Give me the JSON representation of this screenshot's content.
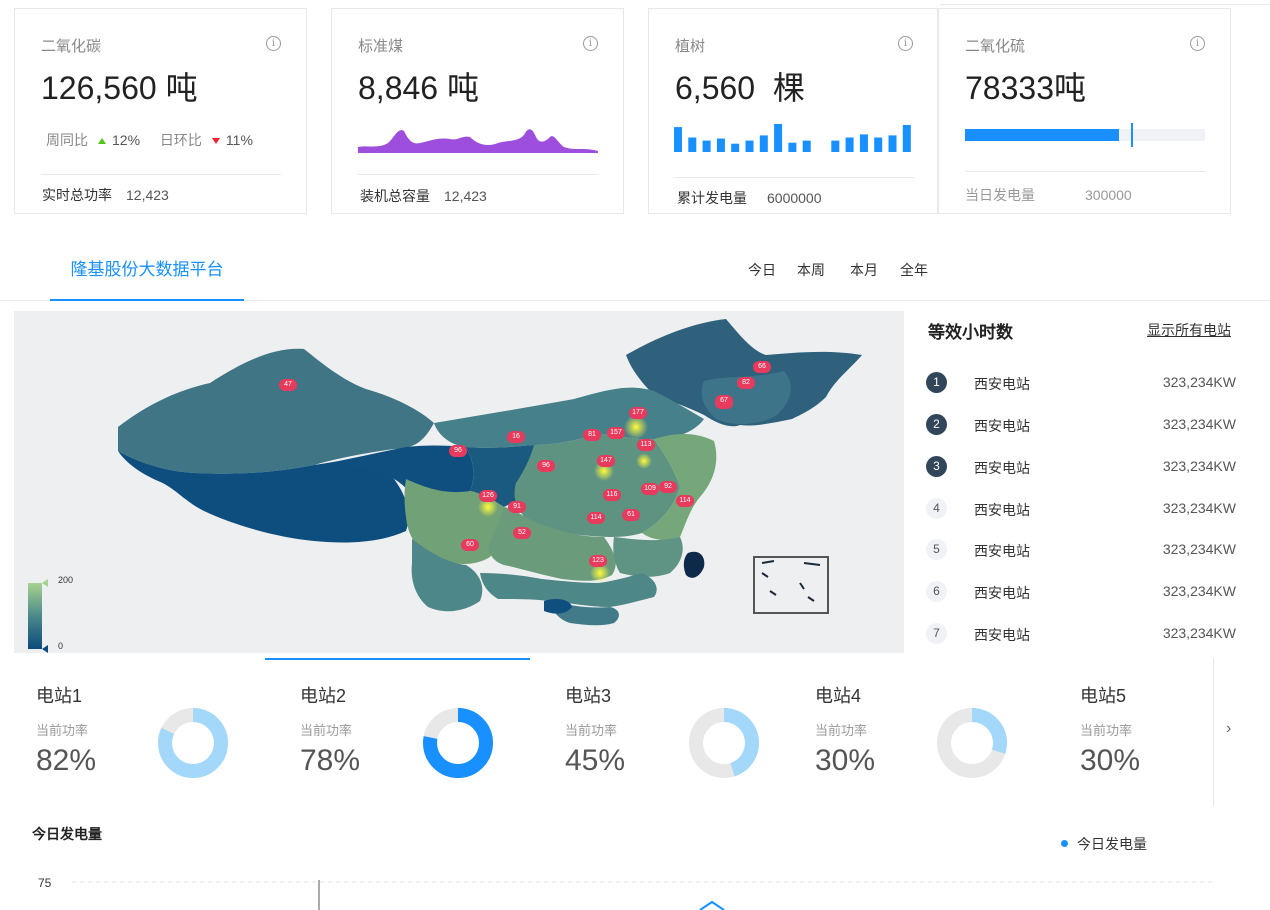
{
  "cards": [
    {
      "title": "二氧化碳",
      "value": "126,560 吨",
      "trend": {
        "week_label": "周同比",
        "week_pct": "12%",
        "day_label": "日环比",
        "day_pct": "11%"
      },
      "footer_label": "实时总功率",
      "footer_value": "12,423"
    },
    {
      "title": "标准煤",
      "value": "8,846 吨",
      "footer_label": "装机总容量",
      "footer_value": "12,423"
    },
    {
      "title": "植树",
      "value": "6,560  棵",
      "bar_values": [
        24,
        14,
        11,
        13,
        8,
        11,
        16,
        27,
        9,
        11,
        0,
        11,
        14,
        17,
        14,
        16,
        26
      ],
      "footer_label": "累计发电量",
      "footer_value": "6000000"
    },
    {
      "title": "二氧化硫",
      "value": "78333吨",
      "progress": 0.64,
      "target": 0.69,
      "footer_label": "当日发电量",
      "footer_value": "300000"
    }
  ],
  "tabs": {
    "main": "隆基股份大数据平台",
    "periods": [
      "今日",
      "本周",
      "本月",
      "全年"
    ]
  },
  "map": {
    "legend": {
      "max": "200",
      "min": "0"
    },
    "markers": [
      "47",
      "177",
      "157",
      "81",
      "113",
      "147",
      "96",
      "126",
      "91",
      "114",
      "61",
      "92",
      "109",
      "116",
      "114",
      "123",
      "52",
      "60",
      "16",
      "96",
      "67",
      "82",
      "67",
      "66"
    ]
  },
  "ranking": {
    "title": "等效小时数",
    "link": "显示所有电站",
    "items": [
      {
        "rank": "1",
        "name": "西安电站",
        "value": "323,234KW"
      },
      {
        "rank": "2",
        "name": "西安电站",
        "value": "323,234KW"
      },
      {
        "rank": "3",
        "name": "西安电站",
        "value": "323,234KW"
      },
      {
        "rank": "4",
        "name": "西安电站",
        "value": "323,234KW"
      },
      {
        "rank": "5",
        "name": "西安电站",
        "value": "323,234KW"
      },
      {
        "rank": "6",
        "name": "西安电站",
        "value": "323,234KW"
      },
      {
        "rank": "7",
        "name": "西安电站",
        "value": "323,234KW"
      }
    ]
  },
  "stations": [
    {
      "name": "电站1",
      "label": "当前功率",
      "value": "82%",
      "ratio": 0.82,
      "color": "#a3d8fb"
    },
    {
      "name": "电站2",
      "label": "当前功率",
      "value": "78%",
      "ratio": 0.78,
      "color": "#1890ff"
    },
    {
      "name": "电站3",
      "label": "当前功率",
      "value": "45%",
      "ratio": 0.45,
      "color": "#a3d8fb"
    },
    {
      "name": "电站4",
      "label": "当前功率",
      "value": "30%",
      "ratio": 0.3,
      "color": "#a3d8fb"
    },
    {
      "name": "电站5",
      "label": "当前功率",
      "value": "30%"
    }
  ],
  "next_icon": "chevron-right-icon",
  "chart": {
    "title": "今日发电量",
    "legend": "今日发电量",
    "ytick": "75"
  },
  "colors": {
    "accent": "#1890ff",
    "purple": "#9d4edd",
    "up": "#52c41a",
    "down": "#f5222d"
  }
}
